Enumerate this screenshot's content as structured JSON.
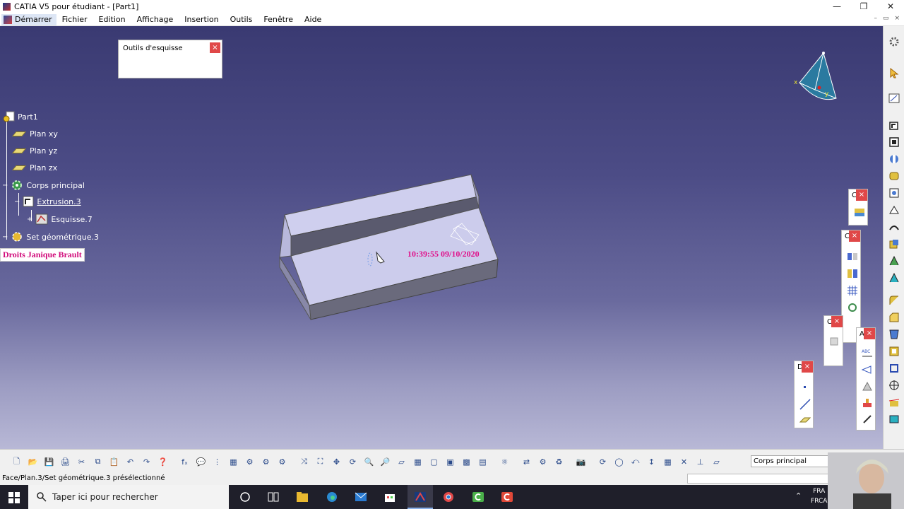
{
  "window": {
    "title": "CATIA V5 pour étudiant - [Part1]",
    "minimize": "—",
    "maximize": "❐",
    "close": "✕"
  },
  "menu": {
    "start": "Démarrer",
    "items": [
      "Fichier",
      "Edition",
      "Affichage",
      "Insertion",
      "Outils",
      "Fenêtre",
      "Aide"
    ]
  },
  "sketch_tools": {
    "title": "Outils d'esquisse",
    "close": "×"
  },
  "tree": {
    "root": "Part1",
    "plane_xy": "Plan xy",
    "plane_yz": "Plan yz",
    "plane_zx": "Plan zx",
    "body": "Corps principal",
    "extrusion": "Extrusion.3",
    "sketch": "Esquisse.7",
    "geoset": "Set géométrique.3"
  },
  "overlay": {
    "rights": "Droits Janique Brault",
    "timestamp": "10:39:55  09/10/2020"
  },
  "compass": {
    "x": "x",
    "y": "y"
  },
  "floating_toolbars": {
    "c1": "C",
    "c2": "C",
    "c3": "C",
    "a": "A",
    "d": "D",
    "close": "×"
  },
  "toolbar": {
    "current_body": "Corps principal",
    "tools": [
      "new-icon",
      "open-icon",
      "save-icon",
      "print-icon",
      "cut-icon",
      "copy-icon",
      "paste-icon",
      "undo-icon",
      "redo-icon",
      "whats-this-icon",
      "formula-icon",
      "comment-icon",
      "knowledge-icon",
      "table-icon",
      "catalog-icon",
      "measure-icon",
      "analysis-icon",
      "fly-icon",
      "fit-all-icon",
      "pan-icon",
      "rotate-icon",
      "zoom-in-icon",
      "zoom-out-icon",
      "normal-view-icon",
      "multi-view-icon",
      "iso-view-icon",
      "render-icon",
      "hide-show-icon",
      "swap-icon",
      "update-icon",
      "compass-icon",
      "snap-icon",
      "constraint-icon",
      "capture-icon",
      "refresh-icon",
      "world-icon",
      "axis-icon",
      "dimension-icon",
      "grid-icon",
      "cut-plane-icon",
      "plane-icon"
    ]
  },
  "status": {
    "message": "Face/Plan.3/Set géométrique.3 présélectionné"
  },
  "taskbar": {
    "search_placeholder": "Taper ici pour rechercher",
    "lang1": "FRA",
    "lang2": "FRCA"
  },
  "colors": {
    "timestamp": "#e0108a",
    "rights": "#d10a7a",
    "close_button": "#e04848"
  }
}
